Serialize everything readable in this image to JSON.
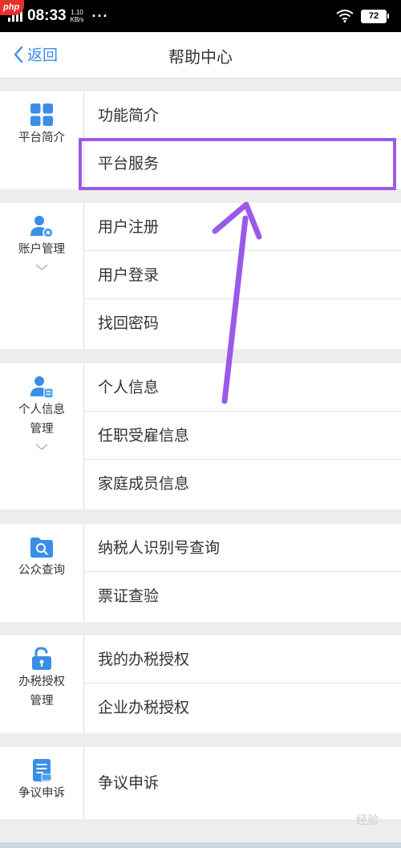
{
  "status_bar": {
    "time": "08:33",
    "speed_value": "1.10",
    "speed_unit": "KB/s",
    "dots": "···",
    "battery": "72",
    "watermark": "php"
  },
  "nav": {
    "back_label": "返回",
    "title": "帮助中心"
  },
  "groups": [
    {
      "category": "平台简介",
      "icon": "grid-icon",
      "expandable": false,
      "items": [
        "功能简介",
        "平台服务"
      ]
    },
    {
      "category": "账户管理",
      "icon": "user-settings-icon",
      "expandable": true,
      "items": [
        "用户注册",
        "用户登录",
        "找回密码"
      ]
    },
    {
      "category_lines": [
        "个人信息",
        "管理"
      ],
      "icon": "user-card-icon",
      "expandable": true,
      "items": [
        "个人信息",
        "任职受雇信息",
        "家庭成员信息"
      ]
    },
    {
      "category": "公众查询",
      "icon": "search-folder-icon",
      "expandable": false,
      "items": [
        "纳税人识别号查询",
        "票证查验"
      ]
    },
    {
      "category_lines": [
        "办税授权",
        "管理"
      ],
      "icon": "unlock-icon",
      "expandable": false,
      "items": [
        "我的办税授权",
        "企业办税授权"
      ]
    },
    {
      "category": "争议申诉",
      "icon": "document-icon",
      "expandable": false,
      "items": [
        "争议申诉"
      ]
    }
  ],
  "highlighted_item": "平台服务",
  "watermark_footer": "经验",
  "colors": {
    "accent": "#3a8ee6",
    "highlight": "#9b59e8",
    "background": "#ededed"
  }
}
